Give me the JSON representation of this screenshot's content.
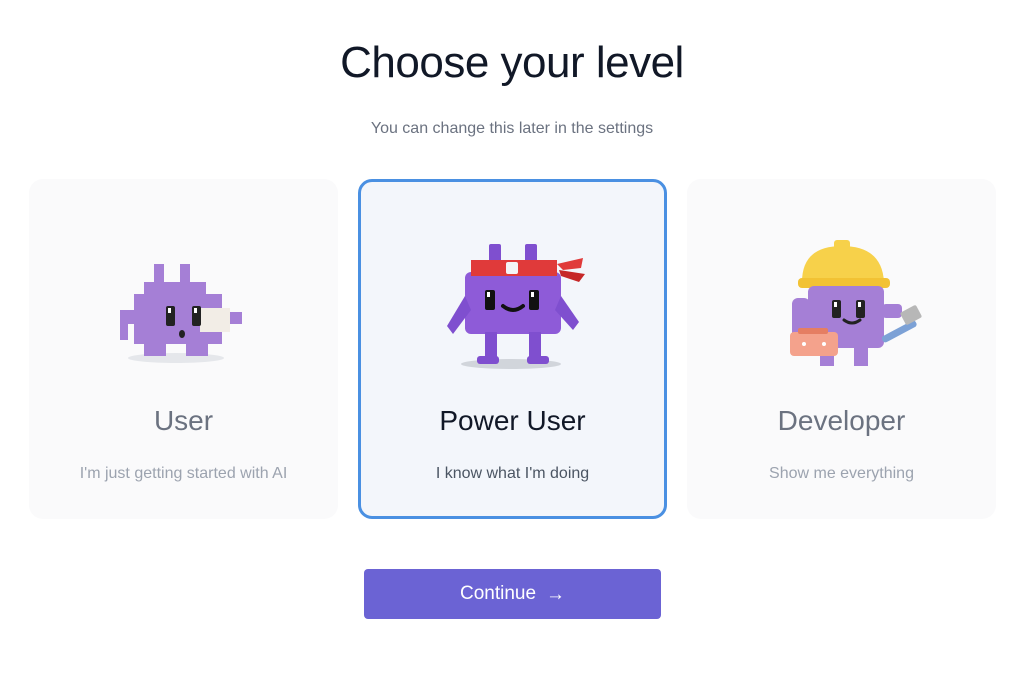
{
  "header": {
    "title": "Choose your level",
    "subtitle": "You can change this later in the settings"
  },
  "levels": [
    {
      "title": "User",
      "description": "I'm just getting started with AI",
      "selected": false,
      "mascot_icon": "mascot-user-icon"
    },
    {
      "title": "Power User",
      "description": "I know what I'm doing",
      "selected": true,
      "mascot_icon": "mascot-power-user-icon"
    },
    {
      "title": "Developer",
      "description": "Show me everything",
      "selected": false,
      "mascot_icon": "mascot-developer-icon"
    }
  ],
  "actions": {
    "continue_label": "Continue",
    "continue_icon": "arrow-right-icon"
  },
  "colors": {
    "accent": "#6b63d4",
    "selected_border": "#4a90e2",
    "mascot_purple": "#a57fd6",
    "mascot_dark_purple": "#7f4fcf",
    "headband_red": "#e03a3a",
    "hardhat_yellow": "#f7d14a"
  }
}
